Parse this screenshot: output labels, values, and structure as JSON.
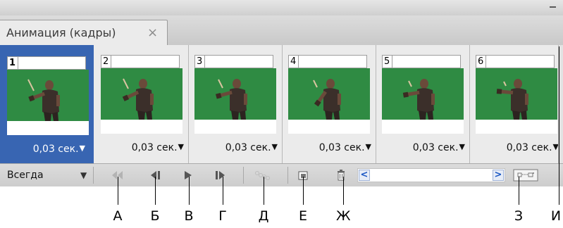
{
  "panel": {
    "tab_title": "Анимация (кадры)",
    "tab_close": "×"
  },
  "frames": [
    {
      "number": "1",
      "delay": "0,03 сек.",
      "selected": true
    },
    {
      "number": "2",
      "delay": "0,03 сек.",
      "selected": false
    },
    {
      "number": "3",
      "delay": "0,03 сек.",
      "selected": false
    },
    {
      "number": "4",
      "delay": "0,03 сек.",
      "selected": false
    },
    {
      "number": "5",
      "delay": "0,03 сек.",
      "selected": false
    },
    {
      "number": "6",
      "delay": "0,03 сек.",
      "selected": false
    }
  ],
  "controls": {
    "loop_value": "Всегда",
    "dropdown_arrow": "▼",
    "delay_arrow": "▼",
    "scroll_left": "<",
    "scroll_right": ">"
  },
  "callouts": [
    "А",
    "Б",
    "В",
    "Г",
    "Д",
    "Е",
    "Ж",
    "З",
    "И"
  ],
  "colors": {
    "selection": "#3865b2",
    "thumbnail_green": "#2f8b43",
    "panel_bg": "#d4d4d4"
  }
}
